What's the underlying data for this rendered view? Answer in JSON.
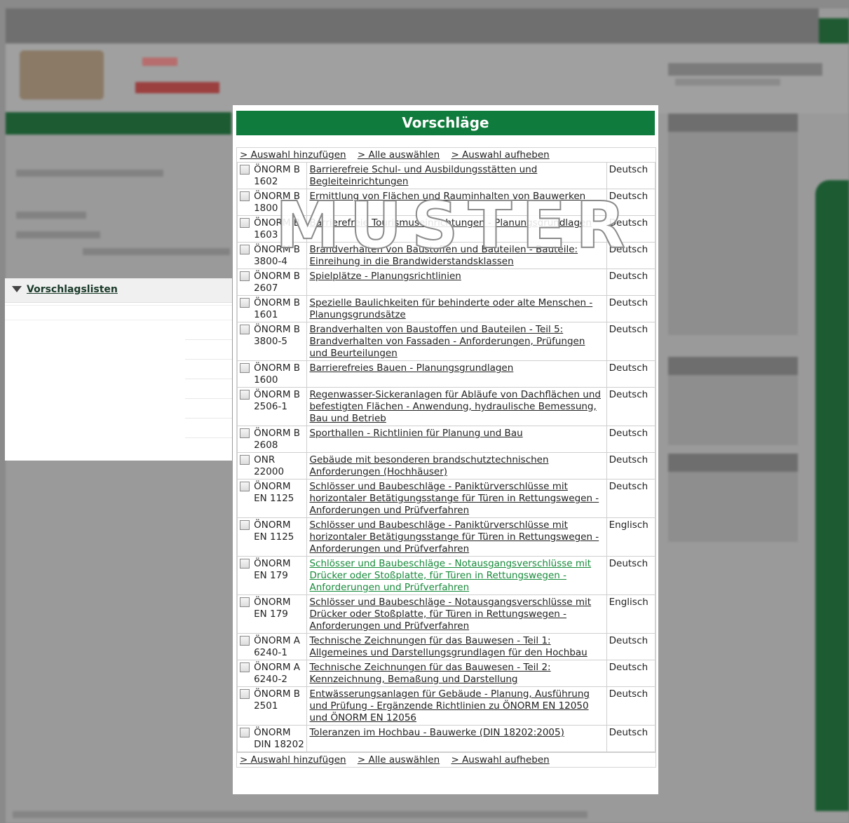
{
  "modal": {
    "title": "Vorschläge",
    "actions": {
      "add_selection": "> Auswahl hinzufügen",
      "select_all": "> Alle auswählen",
      "clear_selection": "> Auswahl aufheben"
    },
    "watermark": "MUSTER",
    "rows": [
      {
        "code": "ÖNORM B 1602",
        "title": "Barrierefreie Schul- und Ausbildungsstätten und Begleiteinrichtungen",
        "lang": "Deutsch",
        "visited": false
      },
      {
        "code": "ÖNORM B 1800",
        "title": "Ermittlung von Flächen und Rauminhalten von Bauwerken",
        "lang": "Deutsch",
        "visited": false
      },
      {
        "code": "ÖNORM B 1603",
        "title": "Barrierefreie Tourismuseinrichtungen - Planungsgrundlagen",
        "lang": "Deutsch",
        "visited": false
      },
      {
        "code": "ÖNORM B 3800-4",
        "title": "Brandverhalten von Baustoffen und Bauteilen - Bauteile: Einreihung in die Brandwiderstandsklassen",
        "lang": "Deutsch",
        "visited": false
      },
      {
        "code": "ÖNORM B 2607",
        "title": "Spielplätze - Planungsrichtlinien",
        "lang": "Deutsch",
        "visited": false
      },
      {
        "code": "ÖNORM B 1601",
        "title": "Spezielle Baulichkeiten für behinderte oder alte Menschen - Planungsgrundsätze",
        "lang": "Deutsch",
        "visited": false
      },
      {
        "code": "ÖNORM B 3800-5",
        "title": "Brandverhalten von Baustoffen und Bauteilen - Teil 5: Brandverhalten von Fassaden - Anforderungen, Prüfungen und Beurteilungen",
        "lang": "Deutsch",
        "visited": false
      },
      {
        "code": "ÖNORM B 1600",
        "title": "Barrierefreies Bauen - Planungsgrundlagen",
        "lang": "Deutsch",
        "visited": false
      },
      {
        "code": "ÖNORM B 2506-1",
        "title": "Regenwasser-Sickeranlagen für Abläufe von Dachflächen und befestigten Flächen - Anwendung, hydraulische Bemessung, Bau und Betrieb",
        "lang": "Deutsch",
        "visited": false
      },
      {
        "code": "ÖNORM B 2608",
        "title": "Sporthallen - Richtlinien für Planung und Bau",
        "lang": "Deutsch",
        "visited": false
      },
      {
        "code": "ONR 22000",
        "title": "Gebäude mit besonderen brandschutztechnischen Anforderungen (Hochhäuser)",
        "lang": "Deutsch",
        "visited": false
      },
      {
        "code": "ÖNORM EN 1125",
        "title": "Schlösser und Baubeschläge - Paniktürverschlüsse mit horizontaler Betätigungsstange für Türen in Rettungswegen - Anforderungen und Prüfverfahren",
        "lang": "Deutsch",
        "visited": false
      },
      {
        "code": "ÖNORM EN 1125",
        "title": "Schlösser und Baubeschläge - Paniktürverschlüsse mit horizontaler Betätigungsstange für Türen in Rettungswegen - Anforderungen und Prüfverfahren",
        "lang": "Englisch",
        "visited": false
      },
      {
        "code": "ÖNORM EN 179",
        "title": "Schlösser und Baubeschläge - Notausgangsverschlüsse mit Drücker oder Stoßplatte, für Türen in Rettungswegen - Anforderungen und Prüfverfahren",
        "lang": "Deutsch",
        "visited": true
      },
      {
        "code": "ÖNORM EN 179",
        "title": "Schlösser und Baubeschläge - Notausgangsverschlüsse mit Drücker oder Stoßplatte, für Türen in Rettungswegen - Anforderungen und Prüfverfahren",
        "lang": "Englisch",
        "visited": false
      },
      {
        "code": "ÖNORM A 6240-1",
        "title": "Technische Zeichnungen für das Bauwesen - Teil 1: Allgemeines und Darstellungsgrundlagen für den Hochbau",
        "lang": "Deutsch",
        "visited": false
      },
      {
        "code": "ÖNORM A 6240-2",
        "title": "Technische Zeichnungen für das Bauwesen - Teil 2: Kennzeichnung, Bemaßung und Darstellung",
        "lang": "Deutsch",
        "visited": false
      },
      {
        "code": "ÖNORM B 2501",
        "title": "Entwässerungsanlagen für Gebäude - Planung, Ausführung und Prüfung - Ergänzende Richtlinien zu ÖNORM EN 12050 und ÖNORM EN 12056",
        "lang": "Deutsch",
        "visited": false
      },
      {
        "code": "ÖNORM DIN 18202",
        "title": "Toleranzen im Hochbau - Bauwerke (DIN 18202:2005)",
        "lang": "Deutsch",
        "visited": false
      }
    ]
  },
  "left_panel": {
    "heading": "Vorschlagslisten"
  },
  "colors": {
    "accent_green": "#0f7b3c",
    "visited_link": "#178a3a",
    "overlay_gray": "#8a8a8a"
  }
}
